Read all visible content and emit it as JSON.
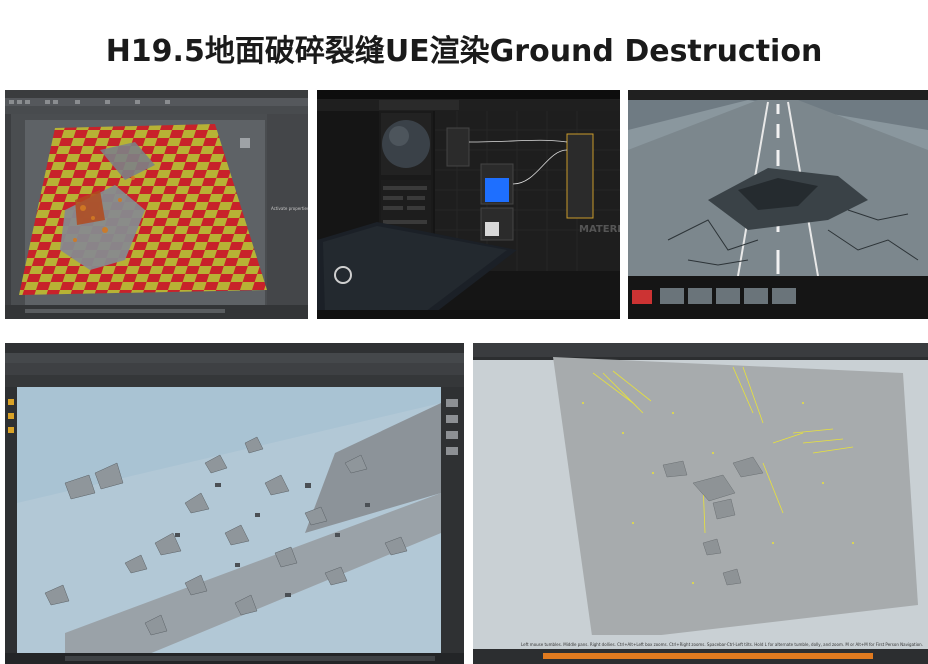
{
  "page": {
    "title": "H19.5地面破碎裂缝UE渲染Ground Destruction"
  },
  "screenshots": [
    {
      "app": "maya",
      "subject": "checkerboard ground fracture"
    },
    {
      "app": "unreal-material-editor",
      "watermark": "MATERI"
    },
    {
      "app": "unreal-viewport",
      "subject": "cracked asphalt road"
    },
    {
      "app": "houdini",
      "pane": "DOP Network",
      "subject": "debris blast"
    },
    {
      "app": "houdini-viewport",
      "subject": "ground plane with yellow velocity vectors",
      "status_text": "Left mouse tumbles. Middle pans. Right dollies. Ctrl+Alt+Left box zooms. Ctrl+Right zooms. Spacebar-Ctrl-Left tilts. Hold L for alternate tumble, dolly, and zoom.   M or Alt+M for First Person Navigation."
    }
  ],
  "colors": {
    "checker_red": "#c8222a",
    "checker_yellow": "#b7b235",
    "accent_blue": "#1e6fff",
    "houdini_sky": "#a9c3d3",
    "vector_yellow": "#e8e23a"
  }
}
